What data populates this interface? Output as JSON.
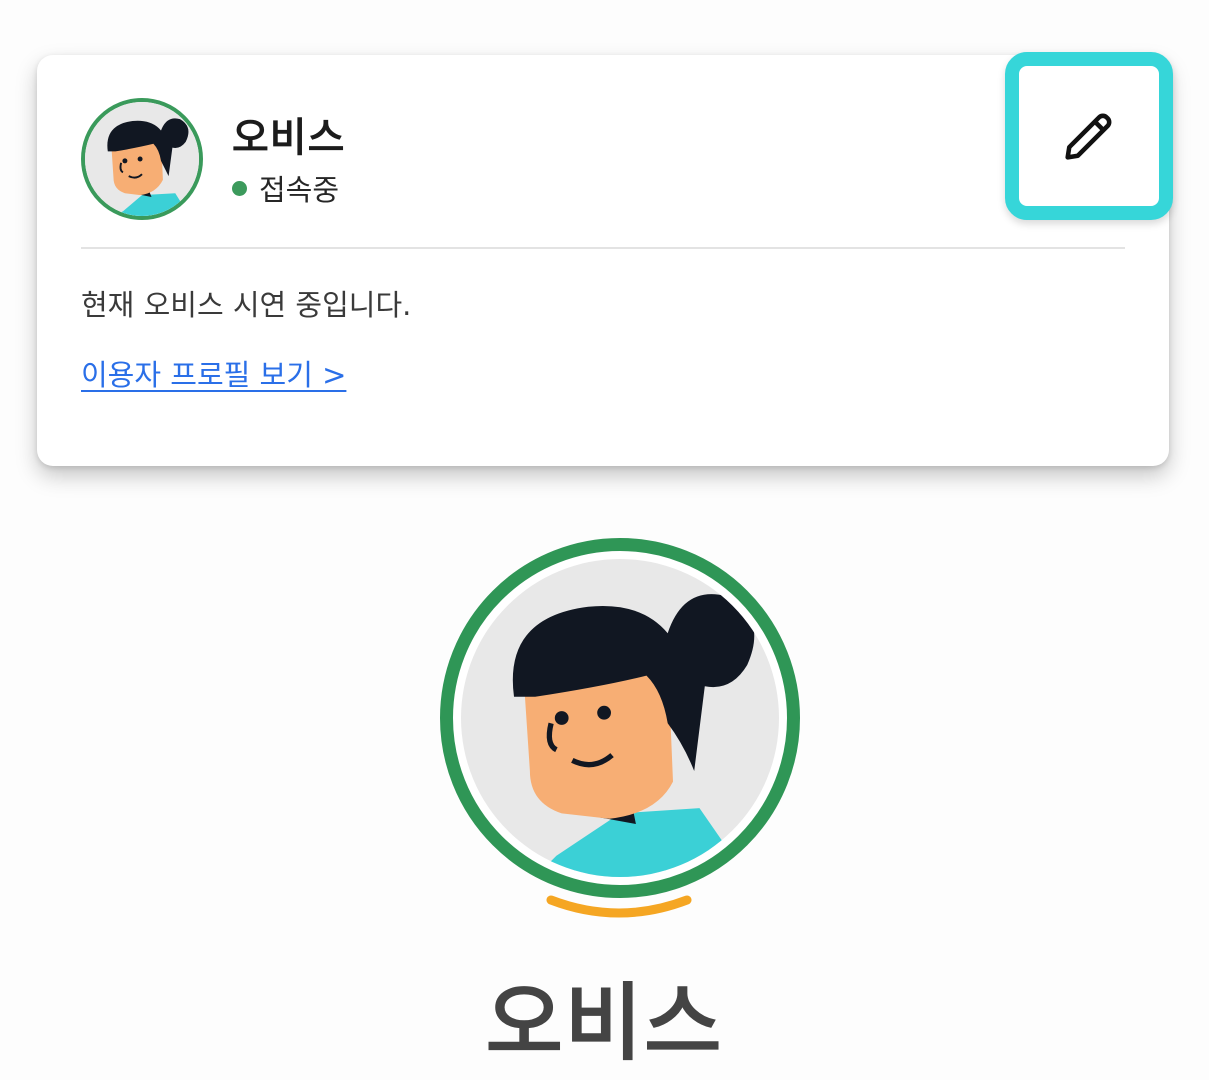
{
  "profile_card": {
    "name": "오비스",
    "status_text": "접속중",
    "status_color": "#3c9a5c",
    "bio": "현재 오비스 시연 중입니다.",
    "profile_link_label": "이용자 프로필 보기 >",
    "edit_icon": "pencil-icon",
    "highlight_color": "#36d6d9"
  },
  "main_profile": {
    "name": "오비스",
    "ring_color": "#2f9656",
    "accent_color": "#f5a623"
  }
}
